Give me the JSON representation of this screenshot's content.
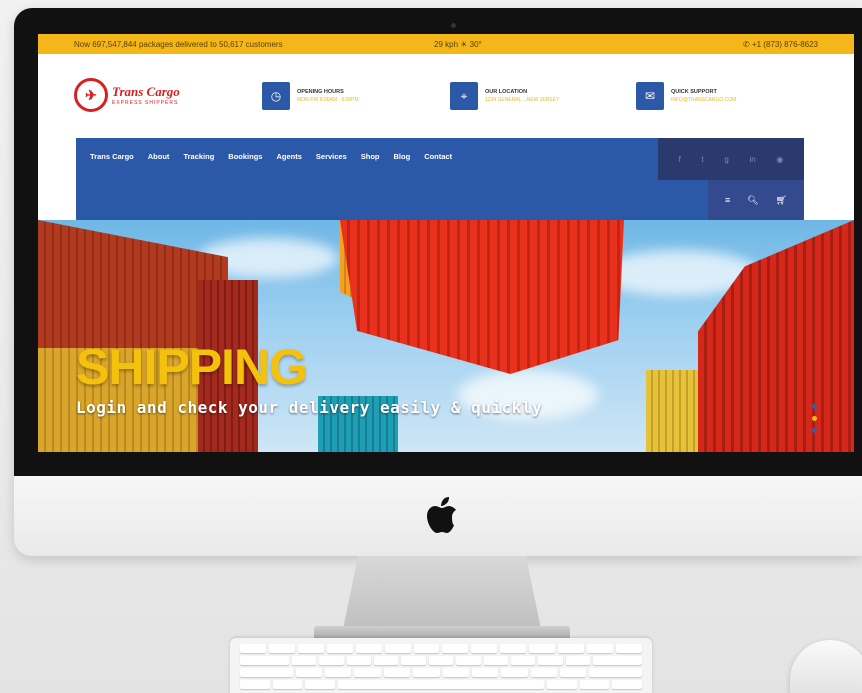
{
  "topbar": {
    "left_text": "Now 697,547,844 packages delivered to 50,617 customers",
    "weather": "29 kph  ☀ 30°",
    "phone": "✆ +1 (873) 876-8623"
  },
  "header": {
    "logo_name": "Trans Cargo",
    "logo_sub": "EXPRESS SHIPPERS",
    "info": [
      {
        "title": "OPENING HOURS",
        "sub": "MON-FRI 8:00AM - 5:00PM",
        "icon": "clock-icon"
      },
      {
        "title": "OUR LOCATION",
        "sub": "1234 GENERAL ...NEW JERSEY",
        "icon": "location-icon"
      },
      {
        "title": "QUICK SUPPORT",
        "sub": "INFO@TRANSCARGO.COM",
        "icon": "support-icon"
      }
    ]
  },
  "nav": {
    "items": [
      "Trans Cargo",
      "About",
      "Tracking",
      "Bookings",
      "Agents",
      "Services",
      "Shop",
      "Blog",
      "Contact"
    ]
  },
  "hero": {
    "title": "SHIPPING",
    "subtitle": "Login and check your delivery easily & quickly"
  },
  "colors": {
    "accent_yellow": "#f4b619",
    "brand_blue": "#2b59a8",
    "brand_red": "#d8201f"
  }
}
